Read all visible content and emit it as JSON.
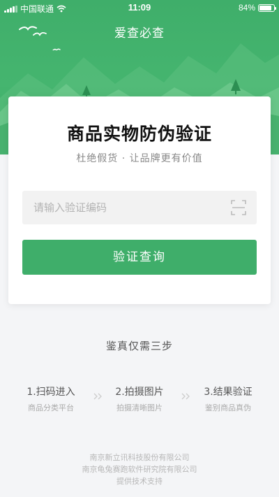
{
  "status_bar": {
    "carrier": "中国联通",
    "time": "11:09",
    "battery_percent": "84%",
    "battery_level": 0.84
  },
  "header": {
    "title": "爱查必查"
  },
  "card": {
    "title": "商品实物防伪验证",
    "subtitle": "杜绝假货 · 让品牌更有价值",
    "input_placeholder": "请输入验证编码",
    "input_value": "",
    "button_label": "验证查询"
  },
  "steps": {
    "title": "鉴真仅需三步",
    "items": [
      {
        "name": "1.扫码进入",
        "desc": "商品分类平台"
      },
      {
        "name": "2.拍摄图片",
        "desc": "拍摄清晰图片"
      },
      {
        "name": "3.结果验证",
        "desc": "鉴别商品真伪"
      }
    ]
  },
  "footer": {
    "line1": "南京新立讯科技股份有限公司",
    "line2": "南京龟兔赛跑软件研究院有限公司",
    "line3": "提供技术支持"
  },
  "colors": {
    "brand_green": "#3fae6a",
    "background": "#f4f5f7"
  },
  "icons": {
    "scan": "scan-frame-icon",
    "wifi": "wifi-icon",
    "battery": "battery-icon",
    "signal": "signal-icon",
    "birds": "birds-icon",
    "step_separator": "double-chevron-right-icon"
  }
}
